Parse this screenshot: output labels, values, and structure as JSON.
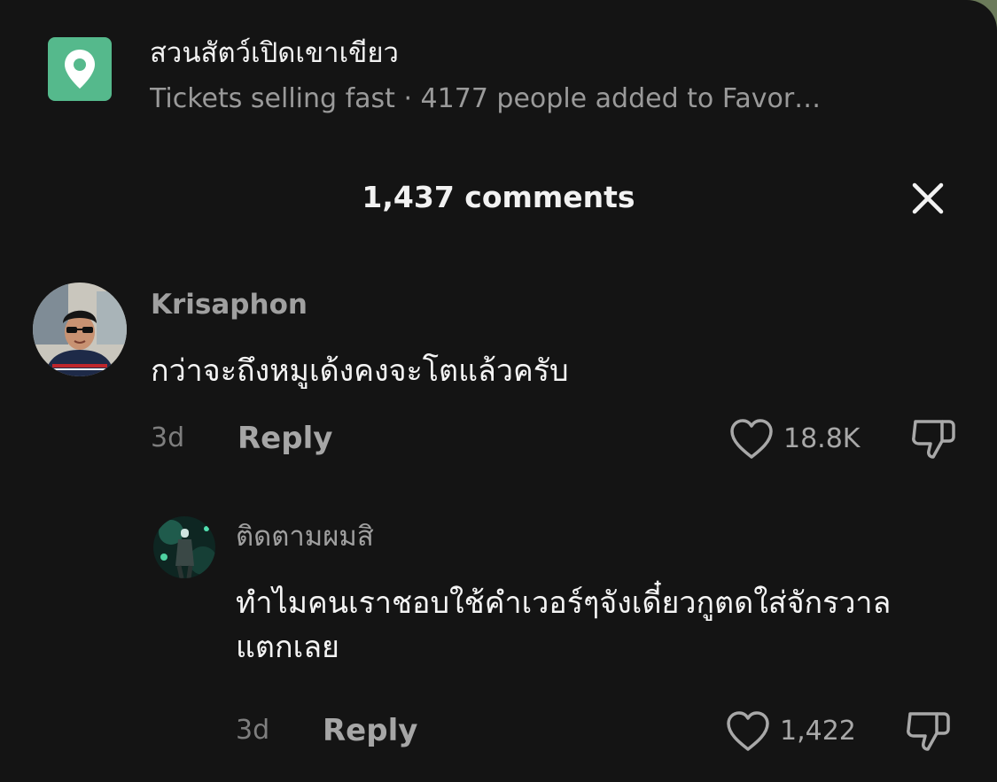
{
  "poi": {
    "icon": "location-pin-icon",
    "icon_bg": "#55b98c",
    "title": "สวนสัตว์เปิดเขาเขียว",
    "subtitle": "Tickets selling fast · 4177 people added to Favor…"
  },
  "header": {
    "title": "1,437 comments",
    "close_icon": "close-icon"
  },
  "comments": [
    {
      "username": "Krisaphon",
      "text": "กว่าจะถึงหมูเด้งคงจะโตแล้วครับ",
      "age": "3d",
      "reply_label": "Reply",
      "likes": "18.8K"
    },
    {
      "username": "ติดตามผมสิ",
      "text": "ทำไมคนเราชอบใช้คำเวอร์ๆจังเดี๋ยวกูตดใส่จักรวาลแตกเลย",
      "age": "3d",
      "reply_label": "Reply",
      "likes": "1,422"
    }
  ]
}
